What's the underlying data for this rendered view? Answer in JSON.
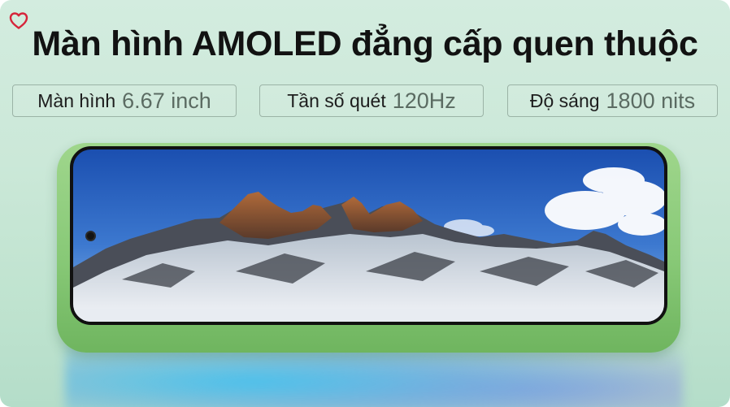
{
  "banner": {
    "title": "Màn hình AMOLED đẳng cấp quen thuộc",
    "specs": [
      {
        "label": "Màn hình",
        "value": "6.67 inch"
      },
      {
        "label": "Tần số quét",
        "value": "120Hz"
      },
      {
        "label": "Độ sáng",
        "value": "1800 nits"
      }
    ]
  },
  "icons": {
    "favorite": "heart-icon"
  },
  "colors": {
    "background": "#cbe8d8",
    "phone_body": "#88c977",
    "heart": "#d6243a",
    "title": "#121212",
    "spec_value": "#5b6b62"
  }
}
